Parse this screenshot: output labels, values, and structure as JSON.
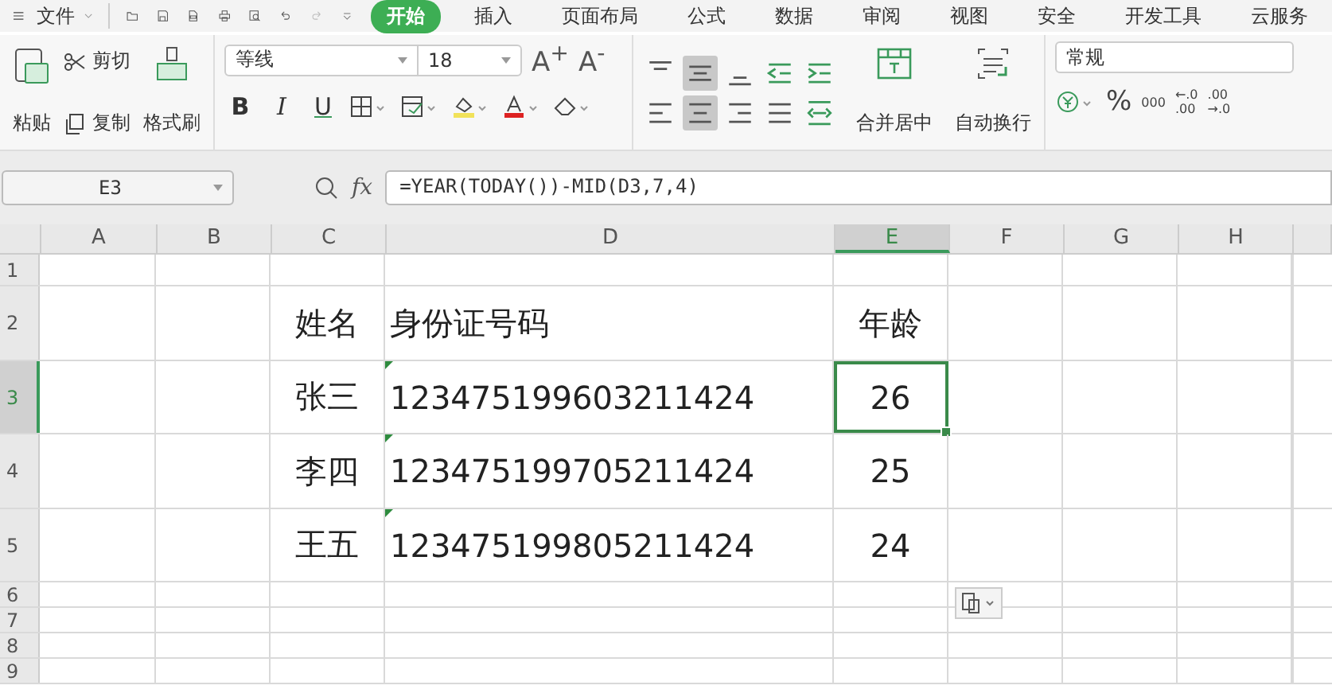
{
  "menu": {
    "file": "文件",
    "tabs": [
      {
        "label": "开始",
        "selected": true
      },
      {
        "label": "插入",
        "selected": false
      },
      {
        "label": "页面布局",
        "selected": false
      },
      {
        "label": "公式",
        "selected": false
      },
      {
        "label": "数据",
        "selected": false
      },
      {
        "label": "审阅",
        "selected": false
      },
      {
        "label": "视图",
        "selected": false
      },
      {
        "label": "安全",
        "selected": false
      },
      {
        "label": "开发工具",
        "selected": false
      },
      {
        "label": "云服务",
        "selected": false
      }
    ]
  },
  "ribbon": {
    "paste": "粘贴",
    "cut": "剪切",
    "copy": "复制",
    "format_painter": "格式刷",
    "font_name": "等线",
    "font_size": "18",
    "grow_font": "A$^{+}$",
    "shrink_font": "A$^{-}$",
    "bold": "B",
    "italic": "I",
    "underline": "U",
    "align_buttons": [
      {
        "kind": "top",
        "selected": false
      },
      {
        "kind": "middle",
        "selected": true
      },
      {
        "kind": "bottom",
        "selected": false
      },
      {
        "kind": "outdent",
        "selected": false
      },
      {
        "kind": "indent",
        "selected": false
      },
      {
        "kind": "left",
        "selected": false
      },
      {
        "kind": "center",
        "selected": true
      },
      {
        "kind": "right",
        "selected": false
      },
      {
        "kind": "justify",
        "selected": false
      },
      {
        "kind": "distribute",
        "selected": false
      }
    ],
    "merge_center": "合并居中",
    "wrap_text": "自动换行",
    "number_format": "常规",
    "percent": "%",
    "thousands": "000",
    "add_decimal": [
      "←.0",
      ".00"
    ],
    "remove_decimal": [
      ".00",
      "→.0"
    ]
  },
  "formula_bar": {
    "name_box": "E3",
    "fx": "fx",
    "formula": "=YEAR(TODAY())-MID(D3,7,4)"
  },
  "sheet": {
    "columns": [
      {
        "label": "A",
        "selected": false
      },
      {
        "label": "B",
        "selected": false
      },
      {
        "label": "C",
        "selected": false
      },
      {
        "label": "D",
        "selected": false
      },
      {
        "label": "E",
        "selected": true
      },
      {
        "label": "F",
        "selected": false
      },
      {
        "label": "G",
        "selected": false
      },
      {
        "label": "H",
        "selected": false
      }
    ],
    "rows": [
      {
        "label": "1",
        "selected": false,
        "cells": {}
      },
      {
        "label": "2",
        "selected": false,
        "cells": {
          "c": {
            "text": "姓名",
            "error_flag": false,
            "selected": false
          },
          "d": {
            "text": "身份证号码",
            "error_flag": false,
            "selected": false
          },
          "e": {
            "text": "年龄",
            "error_flag": false,
            "selected": false
          }
        }
      },
      {
        "label": "3",
        "selected": true,
        "cells": {
          "c": {
            "text": "张三",
            "error_flag": false,
            "selected": false
          },
          "d": {
            "text": "123475199603211424",
            "error_flag": true,
            "selected": false
          },
          "e": {
            "text": "26",
            "error_flag": false,
            "selected": true
          }
        }
      },
      {
        "label": "4",
        "selected": false,
        "cells": {
          "c": {
            "text": "李四",
            "error_flag": false,
            "selected": false
          },
          "d": {
            "text": "123475199705211424",
            "error_flag": true,
            "selected": false
          },
          "e": {
            "text": "25",
            "error_flag": false,
            "selected": false
          }
        }
      },
      {
        "label": "5",
        "selected": false,
        "cells": {
          "c": {
            "text": "王五",
            "error_flag": false,
            "selected": false
          },
          "d": {
            "text": "123475199805211424",
            "error_flag": true,
            "selected": false
          },
          "e": {
            "text": "24",
            "error_flag": false,
            "selected": false
          }
        }
      },
      {
        "label": "6",
        "selected": false,
        "cells": {}
      },
      {
        "label": "7",
        "selected": false,
        "cells": {}
      },
      {
        "label": "8",
        "selected": false,
        "cells": {}
      },
      {
        "label": "9",
        "selected": false,
        "cells": {}
      }
    ]
  }
}
